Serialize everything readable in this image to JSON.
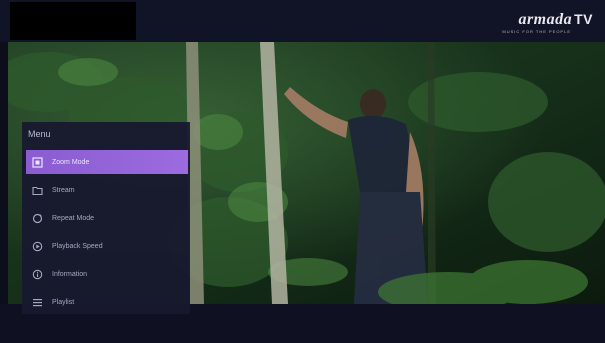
{
  "header": {
    "logo_text": "armada",
    "logo_suffix": "TV",
    "logo_tagline": "MUSIC FOR THE PEOPLE"
  },
  "menu": {
    "title": "Menu",
    "items": [
      {
        "label": "Zoom Mode",
        "icon": "zoom-icon",
        "active": true
      },
      {
        "label": "Stream",
        "icon": "folder-icon",
        "active": false
      },
      {
        "label": "Repeat Mode",
        "icon": "repeat-icon",
        "active": false
      },
      {
        "label": "Playback Speed",
        "icon": "speed-icon",
        "active": false
      },
      {
        "label": "Information",
        "icon": "info-icon",
        "active": false
      },
      {
        "label": "Playlist",
        "icon": "playlist-icon",
        "active": false
      }
    ]
  },
  "colors": {
    "accent": "#9266d8",
    "menu_bg": "#18182e",
    "background": "#0d0e1c"
  }
}
